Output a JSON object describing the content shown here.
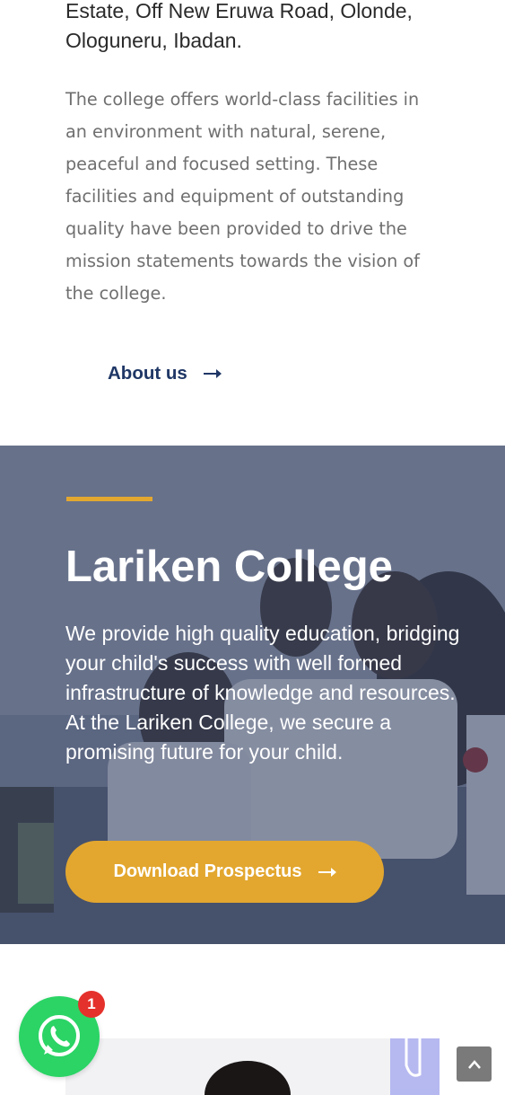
{
  "intro": {
    "address": "Estate, Off New Eruwa Road, Olonde, Ologuneru, Ibadan.",
    "description": "The college offers world-class facilities in an environment with natural, serene, peaceful and focused setting. These facilities and equipment of outstanding quality have been provided to drive the mission statements towards the vision of the college.",
    "about_label": "About us",
    "about_icon": "arrow-right-icon"
  },
  "hero": {
    "title": "Lariken College",
    "text": "We provide high quality education, bridging your child's success with well formed infrastructure of knowledge and resources. At the Lariken College, we secure a promising future for your child.",
    "button_label": "Download Prospectus",
    "button_icon": "arrow-right-icon"
  },
  "widgets": {
    "whatsapp_badge": "1",
    "whatsapp_icon": "whatsapp-icon",
    "scroll_top_icon": "chevron-up-icon"
  },
  "colors": {
    "accent": "#e3a72f",
    "link_blue": "#1f3766",
    "whatsapp_green": "#2bd465",
    "badge_red": "#e5312b"
  }
}
